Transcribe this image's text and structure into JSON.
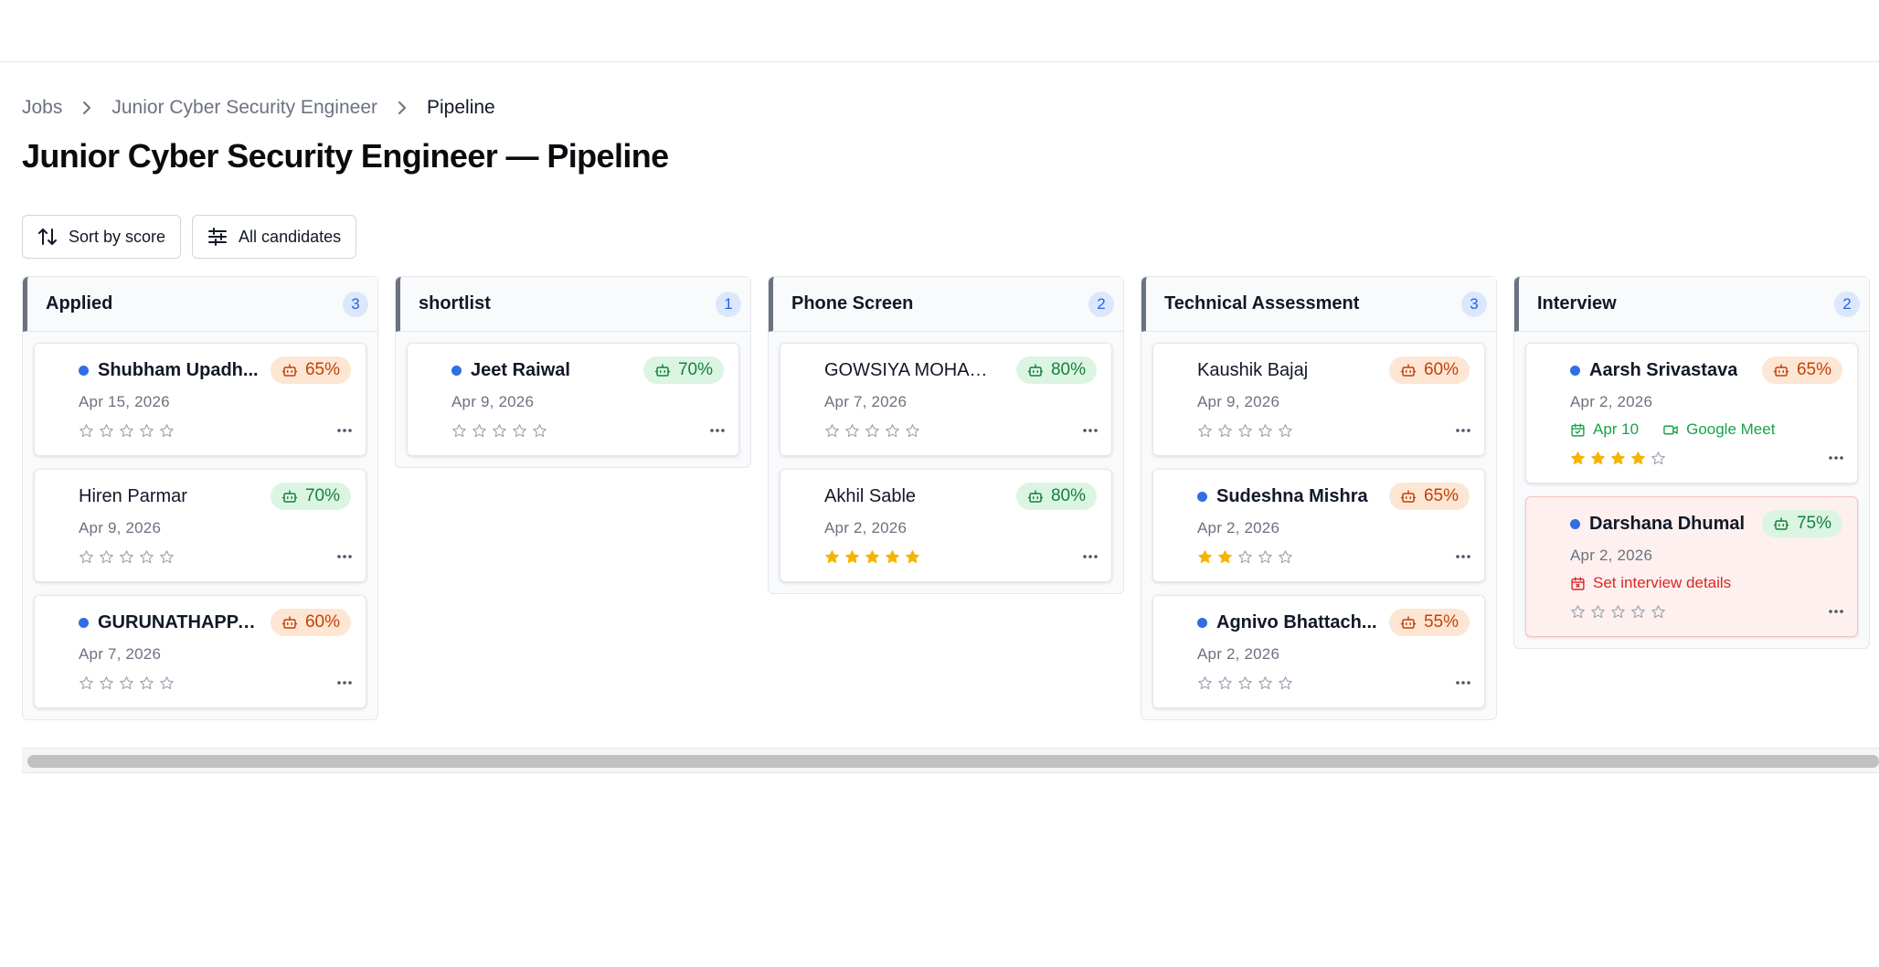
{
  "breadcrumb": {
    "items": [
      "Jobs",
      "Junior Cyber Security Engineer",
      "Pipeline"
    ]
  },
  "page": {
    "title": "Junior Cyber Security Engineer — Pipeline"
  },
  "toolbar": {
    "sort_label": "Sort by score",
    "filter_label": "All candidates"
  },
  "colors": {
    "accent": "#2563eb",
    "score_warn": "#c2410c",
    "score_good": "#15803d",
    "star_filled": "#f5b400",
    "alert_bg": "#fdf0ef"
  },
  "columns": [
    {
      "name": "Applied",
      "count": "3",
      "cards": [
        {
          "name": "Shubham Upadh...",
          "date": "Apr 15, 2026",
          "score": "65%",
          "score_level": "warn",
          "dot": true,
          "rating": 0
        },
        {
          "name": "Hiren Parmar",
          "date": "Apr 9, 2026",
          "score": "70%",
          "score_level": "good",
          "dot": false,
          "rating": 0
        },
        {
          "name": "GURUNATHAPPA...",
          "date": "Apr 7, 2026",
          "score": "60%",
          "score_level": "warn",
          "dot": true,
          "rating": 0
        }
      ]
    },
    {
      "name": "shortlist",
      "count": "1",
      "cards": [
        {
          "name": "Jeet Raiwal",
          "date": "Apr 9, 2026",
          "score": "70%",
          "score_level": "good",
          "dot": true,
          "rating": 0
        }
      ]
    },
    {
      "name": "Phone Screen",
      "count": "2",
      "cards": [
        {
          "name": "GOWSIYA MOHAM...",
          "date": "Apr 7, 2026",
          "score": "80%",
          "score_level": "good",
          "dot": false,
          "rating": 0
        },
        {
          "name": "Akhil Sable",
          "date": "Apr 2, 2026",
          "score": "80%",
          "score_level": "good",
          "dot": false,
          "rating": 5
        }
      ]
    },
    {
      "name": "Technical Assessment",
      "count": "3",
      "cards": [
        {
          "name": "Kaushik Bajaj",
          "date": "Apr 9, 2026",
          "score": "60%",
          "score_level": "warn",
          "dot": false,
          "rating": 0
        },
        {
          "name": "Sudeshna Mishra",
          "date": "Apr 2, 2026",
          "score": "65%",
          "score_level": "warn",
          "dot": true,
          "rating": 2
        },
        {
          "name": "Agnivo Bhattach...",
          "date": "Apr 2, 2026",
          "score": "55%",
          "score_level": "warn",
          "dot": true,
          "rating": 0
        }
      ]
    },
    {
      "name": "Interview",
      "count": "2",
      "cards": [
        {
          "name": "Aarsh Srivastava",
          "date": "Apr 2, 2026",
          "score": "65%",
          "score_level": "warn",
          "dot": true,
          "rating": 4,
          "meta": {
            "type": "scheduled",
            "date": "Apr 10",
            "platform": "Google Meet"
          }
        },
        {
          "name": "Darshana Dhumal",
          "date": "Apr 2, 2026",
          "score": "75%",
          "score_level": "good",
          "dot": true,
          "rating": 0,
          "alert": true,
          "meta": {
            "type": "missing",
            "text": "Set interview details"
          }
        }
      ]
    }
  ]
}
